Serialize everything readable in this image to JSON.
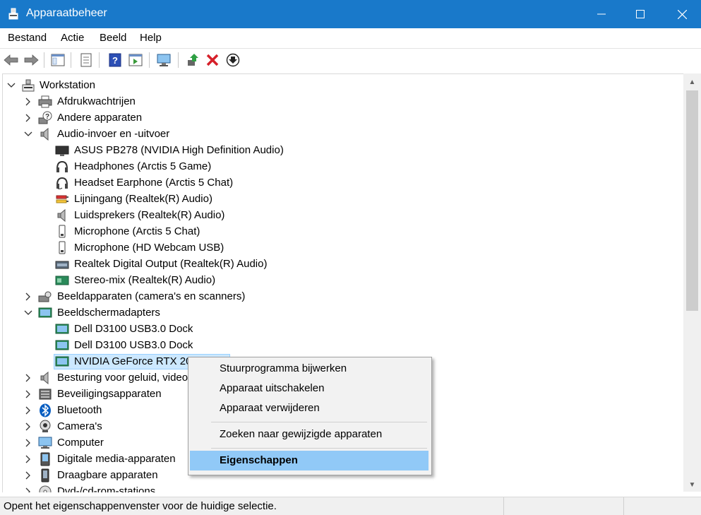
{
  "window": {
    "title": "Apparaatbeheer"
  },
  "menu": [
    "Bestand",
    "Actie",
    "Beeld",
    "Help"
  ],
  "tree": {
    "root": "Workstation",
    "items": [
      "Afdrukwachtrijen",
      "Andere apparaten",
      "Audio-invoer en -uitvoer",
      "ASUS PB278 (NVIDIA High Definition Audio)",
      "Headphones (Arctis 5 Game)",
      "Headset Earphone (Arctis 5 Chat)",
      "Lijningang (Realtek(R) Audio)",
      "Luidsprekers (Realtek(R) Audio)",
      "Microphone (Arctis 5 Chat)",
      "Microphone (HD Webcam USB)",
      "Realtek Digital Output (Realtek(R) Audio)",
      "Stereo-mix (Realtek(R) Audio)",
      "Beeldapparaten (camera's en scanners)",
      "Beeldschermadapters",
      "Dell D3100 USB3.0 Dock",
      "Dell D3100 USB3.0 Dock",
      "NVIDIA GeForce RTX 207",
      "Besturing voor geluid, video",
      "Beveiligingsapparaten",
      "Bluetooth",
      "Camera's",
      "Computer",
      "Digitale media-apparaten",
      "Draagbare apparaten",
      "Dvd-/cd-rom-stations"
    ]
  },
  "context_menu": {
    "items": [
      "Stuurprogramma bijwerken",
      "Apparaat uitschakelen",
      "Apparaat verwijderen",
      "Zoeken naar gewijzigde apparaten",
      "Eigenschappen"
    ],
    "highlighted": "Eigenschappen"
  },
  "status": {
    "text": "Opent het eigenschappenvenster voor de huidige selectie."
  },
  "colors": {
    "titlebar": "#1979ca",
    "highlight": "#91c9f7",
    "selection": "#cce8ff"
  }
}
